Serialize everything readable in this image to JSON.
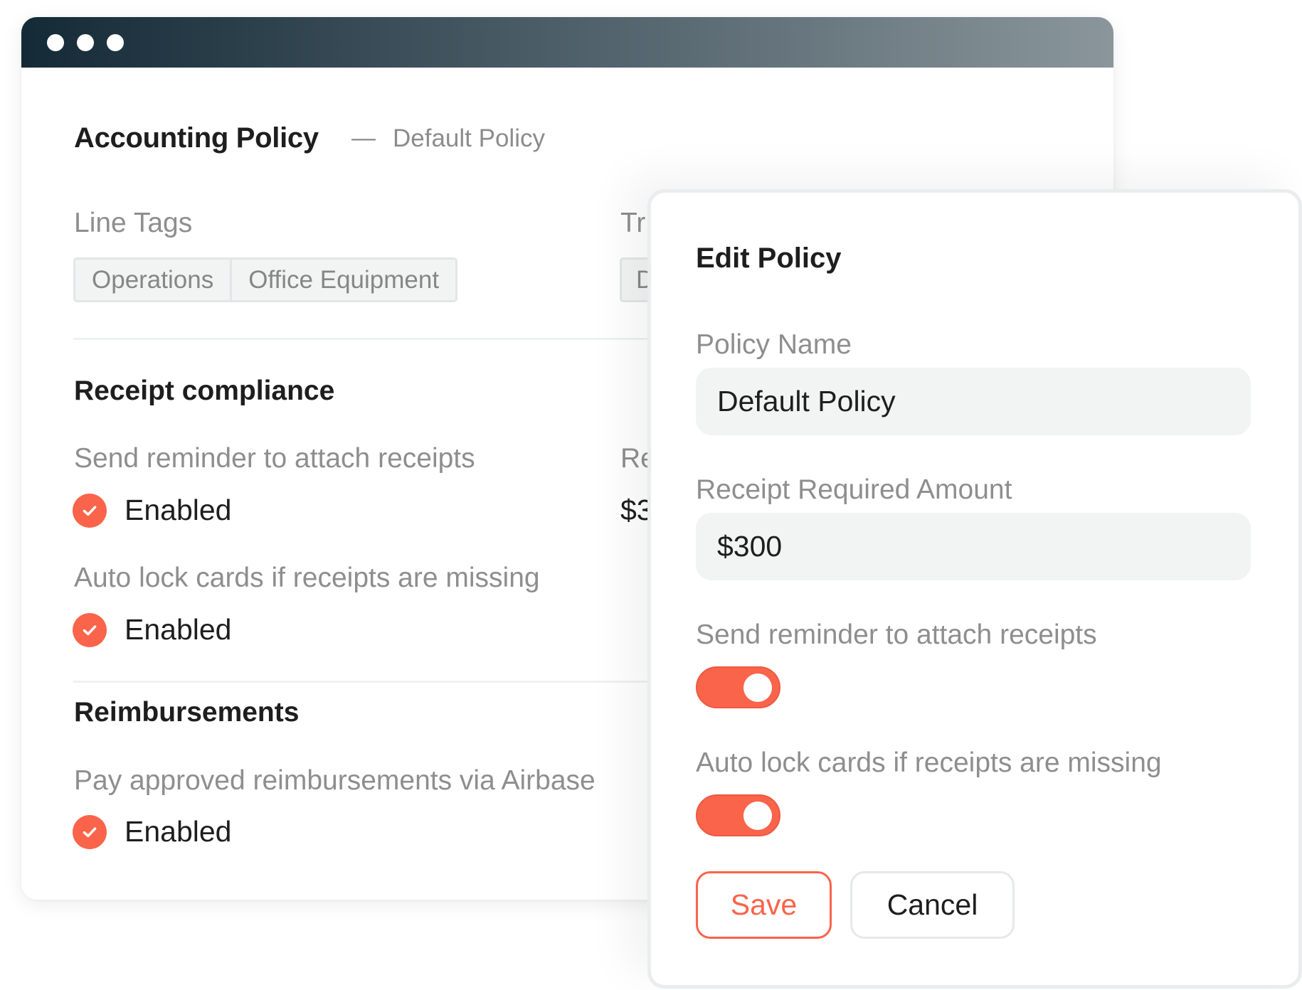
{
  "window": {
    "controls": [
      "dot",
      "dot",
      "dot"
    ],
    "title": "Accounting Policy",
    "title_separator": "—",
    "subtitle": "Default Policy"
  },
  "line_tags": {
    "label": "Line Tags",
    "tags": [
      "Operations",
      "Office Equipment"
    ]
  },
  "second_column": {
    "label_partial": "Tr",
    "tag_partial": "D",
    "receipt_label_partial": "Re",
    "receipt_value_partial": "$3"
  },
  "receipt_compliance": {
    "heading": "Receipt compliance",
    "settings": [
      {
        "label": "Send reminder to attach receipts",
        "status": "Enabled",
        "icon": "check-circle-icon"
      },
      {
        "label": "Auto lock cards if receipts are missing",
        "status": "Enabled",
        "icon": "check-circle-icon"
      }
    ]
  },
  "reimbursements": {
    "heading": "Reimbursements",
    "settings": [
      {
        "label": "Pay approved reimbursements via Airbase",
        "status": "Enabled",
        "icon": "check-circle-icon"
      }
    ]
  },
  "edit_policy": {
    "title": "Edit Policy",
    "policy_name_label": "Policy Name",
    "policy_name_value": "Default Policy",
    "receipt_amount_label": "Receipt Required Amount",
    "receipt_amount_value": "$300",
    "reminder_label": "Send reminder to attach receipts",
    "reminder_on": true,
    "autolock_label": "Auto lock cards if receipts are missing",
    "autolock_on": true,
    "save_label": "Save",
    "cancel_label": "Cancel"
  },
  "colors": {
    "accent": "#fa644a",
    "titlebar_start": "#142a36",
    "titlebar_end": "#8a969b",
    "muted_text": "#8e8e8e",
    "body_text": "#1e1e1e"
  }
}
